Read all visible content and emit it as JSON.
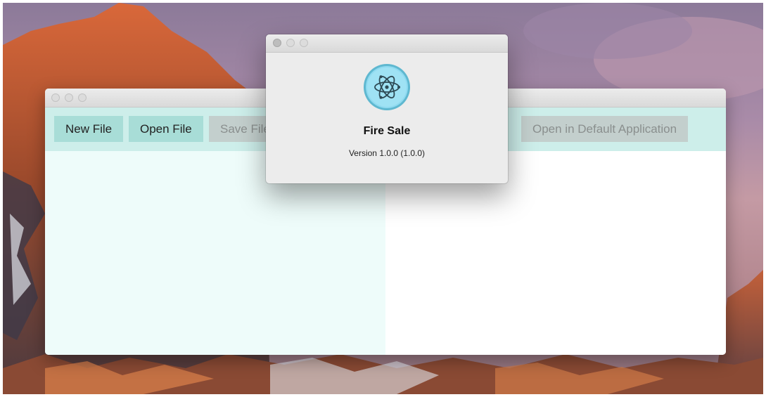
{
  "main_window": {
    "toolbar": {
      "buttons": [
        {
          "label": "New File",
          "enabled": true
        },
        {
          "label": "Open File",
          "enabled": true
        },
        {
          "label": "Save File",
          "enabled": false
        },
        {
          "label": "Open in Default Application",
          "enabled": false
        }
      ]
    }
  },
  "about_dialog": {
    "app_name": "Fire Sale",
    "version": "Version 1.0.0 (1.0.0)",
    "icon": "electron-atom-icon"
  },
  "colors": {
    "toolbar_bg": "#cdeeea",
    "button_enabled": "#a8ddd7",
    "button_disabled": "#c3cfcd",
    "editor_bg": "#eefcfa",
    "icon_circle": "#8fdaf0"
  }
}
